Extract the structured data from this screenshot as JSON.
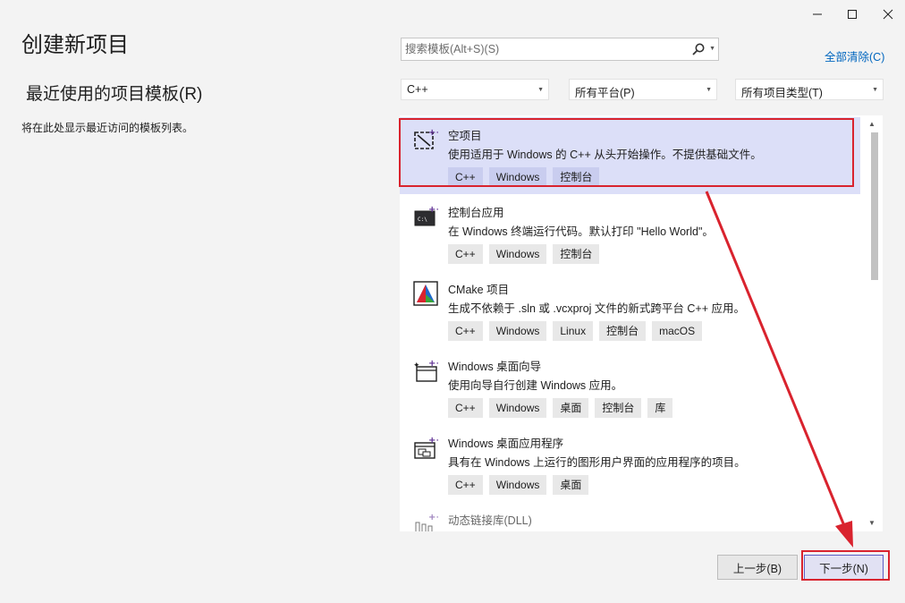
{
  "window": {
    "minimize_glyph": "—",
    "maximize_glyph": "☐",
    "close_glyph": "✕"
  },
  "header": {
    "title": "创建新项目",
    "recent_title": "最近使用的项目模板(R)",
    "recent_empty": "将在此处显示最近访问的模板列表。"
  },
  "search": {
    "placeholder": "搜索模板(Alt+S)(S)",
    "clear_all": "全部清除(C)"
  },
  "filters": {
    "language": "C++",
    "platform": "所有平台(P)",
    "project_type": "所有项目类型(T)"
  },
  "templates": [
    {
      "name": "空项目",
      "description": "使用适用于 Windows 的 C++ 从头开始操作。不提供基础文件。",
      "tags": [
        "C++",
        "Windows",
        "控制台"
      ],
      "selected": true,
      "icon": "empty-project-icon"
    },
    {
      "name": "控制台应用",
      "description": "在 Windows 终端运行代码。默认打印 \"Hello World\"。",
      "tags": [
        "C++",
        "Windows",
        "控制台"
      ],
      "icon": "console-app-icon"
    },
    {
      "name": "CMake 项目",
      "description": "生成不依赖于 .sln 或 .vcxproj 文件的新式跨平台 C++ 应用。",
      "tags": [
        "C++",
        "Windows",
        "Linux",
        "控制台",
        "macOS"
      ],
      "icon": "cmake-icon"
    },
    {
      "name": "Windows 桌面向导",
      "description": "使用向导自行创建 Windows 应用。",
      "tags": [
        "C++",
        "Windows",
        "桌面",
        "控制台",
        "库"
      ],
      "icon": "desktop-wizard-icon"
    },
    {
      "name": "Windows 桌面应用程序",
      "description": "具有在 Windows 上运行的图形用户界面的应用程序的项目。",
      "tags": [
        "C++",
        "Windows",
        "桌面"
      ],
      "icon": "desktop-app-icon"
    },
    {
      "name": "动态链接库(DLL)",
      "description": "",
      "tags": [],
      "icon": "dll-icon"
    }
  ],
  "footer": {
    "back": "上一步(B)",
    "next": "下一步(N)"
  },
  "colors": {
    "accent": "#5c2d91",
    "selection": "#dcdff8",
    "annotation": "#d9232e",
    "link": "#0066bf"
  }
}
